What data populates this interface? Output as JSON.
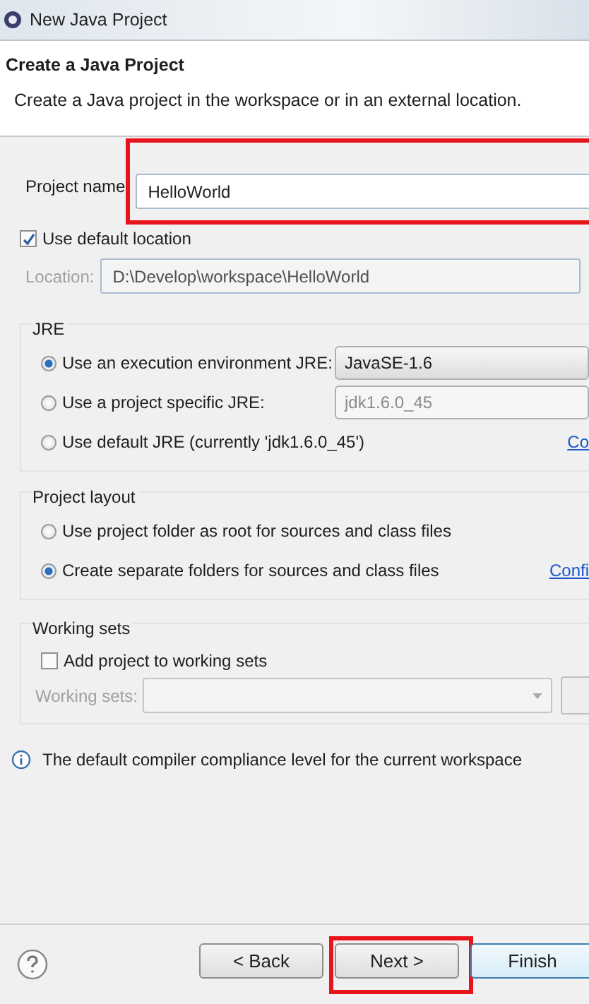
{
  "window": {
    "title": "New Java Project"
  },
  "header": {
    "title": "Create a Java Project",
    "description": "Create a Java project in the workspace or in an external location."
  },
  "project_name": {
    "label": "Project name",
    "value": "HelloWorld",
    "highlighted": true
  },
  "use_default_location": {
    "label": "Use default location",
    "checked": true
  },
  "location": {
    "label": "Location:",
    "value": "D:\\Develop\\workspace\\HelloWorld"
  },
  "jre": {
    "title": "JRE",
    "options": [
      {
        "label": "Use an execution environment JRE:",
        "selected": true,
        "kind": "combo",
        "combo": {
          "value": "JavaSE-1.6",
          "disabled": false
        }
      },
      {
        "label": "Use a project specific JRE:",
        "selected": false,
        "kind": "combo",
        "combo": {
          "value": "jdk1.6.0_45",
          "disabled": true
        }
      },
      {
        "label": "Use default JRE (currently 'jdk1.6.0_45')",
        "selected": false,
        "kind": "link",
        "link": "Co"
      }
    ]
  },
  "project_layout": {
    "title": "Project layout",
    "options": [
      {
        "label": "Use project folder as root for sources and class files",
        "selected": false,
        "kind": "plain"
      },
      {
        "label": "Create separate folders for sources and class files",
        "selected": true,
        "kind": "link",
        "link": "Confi"
      }
    ]
  },
  "working_sets": {
    "title": "Working sets",
    "add": {
      "label": "Add project to working sets",
      "checked": false
    },
    "field_label": "Working sets:"
  },
  "info": "The default compiler compliance level for the current workspace",
  "buttons": [
    {
      "label": "< Back",
      "kind": "normal",
      "highlighted": false
    },
    {
      "label": "Next >",
      "kind": "normal",
      "highlighted": true
    },
    {
      "label": "Finish",
      "kind": "default",
      "highlighted": false
    }
  ]
}
